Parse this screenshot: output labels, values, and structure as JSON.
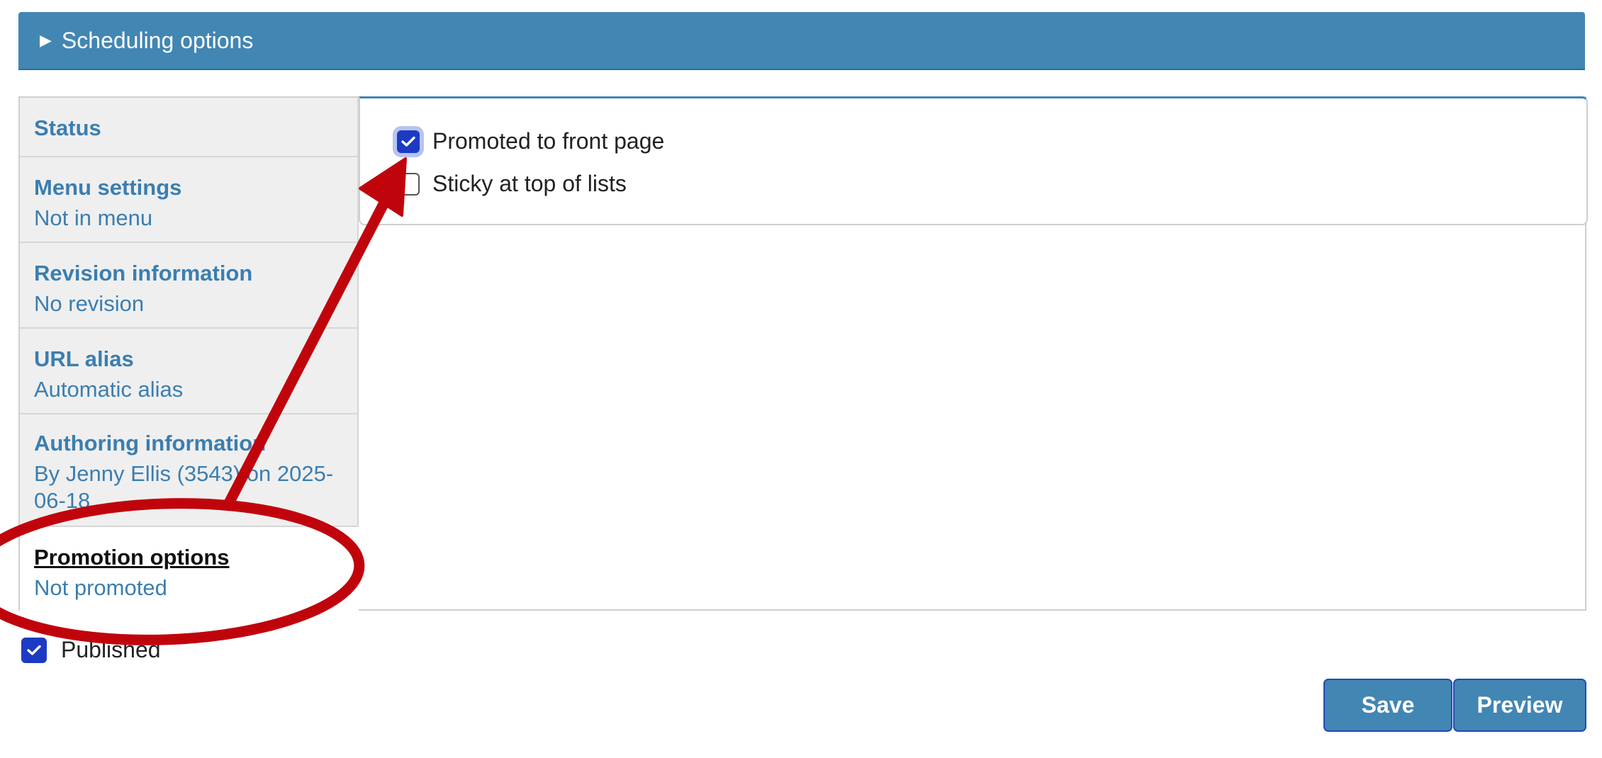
{
  "scheduling": {
    "label": "Scheduling options",
    "icon": "triangle-right-icon"
  },
  "sidebar": {
    "tabs": [
      {
        "title": "Status",
        "summary": ""
      },
      {
        "title": "Menu settings",
        "summary": "Not in menu"
      },
      {
        "title": "Revision information",
        "summary": "No revision"
      },
      {
        "title": "URL alias",
        "summary": "Automatic alias"
      },
      {
        "title": "Authoring information",
        "summary": "By Jenny Ellis (3543) on 2025-06-18"
      },
      {
        "title": "Promotion options",
        "summary": "Not promoted",
        "active": true
      }
    ]
  },
  "promotion": {
    "promoted_label": "Promoted to front page",
    "promoted_checked": true,
    "sticky_label": "Sticky at top of lists",
    "sticky_checked": false
  },
  "published": {
    "label": "Published",
    "checked": true
  },
  "actions": {
    "save_label": "Save",
    "preview_label": "Preview"
  },
  "colors": {
    "accent": "#4286b3",
    "checkbox": "#1d3ac4",
    "link": "#3b7eb0",
    "annotation": "#c0040c"
  }
}
